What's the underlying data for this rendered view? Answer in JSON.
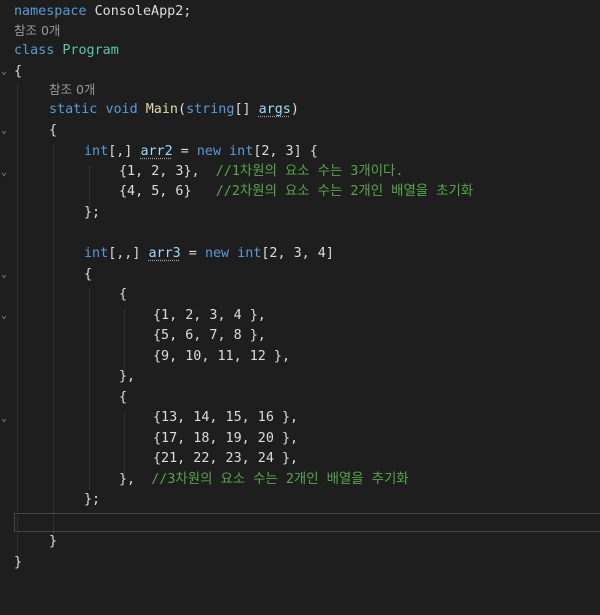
{
  "editor": {
    "lines": [
      {
        "t": "namespace ConsoleApp2;"
      },
      {
        "t": "참조 0개"
      },
      {
        "t": "class Program"
      },
      {
        "t": "{"
      },
      {
        "t": "참조 0개"
      },
      {
        "t": "static void Main(string[] args)"
      },
      {
        "t": "{"
      },
      {
        "t": "int[,] arr2 = new int[2, 3] {"
      },
      {
        "t": "{1, 2, 3},  //1차원의 요소 수는 3개이다."
      },
      {
        "t": "{4, 5, 6}   //2차원의 요소 수는 2개인 배열을 초기화"
      },
      {
        "t": "};"
      },
      {
        "t": ""
      },
      {
        "t": "int[,,] arr3 = new int[2, 3, 4]"
      },
      {
        "t": "{"
      },
      {
        "t": "{"
      },
      {
        "t": "{1, 2, 3, 4 },"
      },
      {
        "t": "{5, 6, 7, 8 },"
      },
      {
        "t": "{9, 10, 11, 12 },"
      },
      {
        "t": "},"
      },
      {
        "t": "{"
      },
      {
        "t": "{13, 14, 15, 16 },"
      },
      {
        "t": "{17, 18, 19, 20 },"
      },
      {
        "t": "{21, 22, 23, 24 },"
      },
      {
        "t": "},  //3차원의 요소 수는 2개인 배열을 추기화"
      },
      {
        "t": "};"
      },
      {
        "t": ""
      },
      {
        "t": "}"
      },
      {
        "t": "}"
      }
    ],
    "tokens": {
      "kw_namespace": "namespace",
      "ns_name": "ConsoleApp2;",
      "ref_count_1": "참조 0개",
      "kw_class": "class",
      "class_name": "Program",
      "brace_open": "{",
      "brace_close": "}",
      "ref_count_2": "참조 0개",
      "kw_static": "static",
      "kw_void": "void",
      "method_name": "Main",
      "paren_open": "(",
      "kw_string": "string",
      "arr_bracket": "[]",
      "param_name": "args",
      "paren_close": ")",
      "kw_int": "int",
      "arr2_dims": "[,]",
      "var_arr2": "arr2",
      "eq": " = ",
      "kw_new": "new",
      "arr2_size": "[2, 3] {",
      "row1": "{1, 2, 3},",
      "comment1": "//1차원의 요소 수는 3개이다.",
      "row2": "{4, 5, 6}",
      "comment2": "//2차원의 요소 수는 2개인 배열을 초기화",
      "close_semi": "};",
      "arr3_dims": "[,,]",
      "var_arr3": "arr3",
      "arr3_size": "[2, 3, 4]",
      "r3_1": "{1, 2, 3, 4 },",
      "r3_2": "{5, 6, 7, 8 },",
      "r3_3": "{9, 10, 11, 12 },",
      "block_close_comma": "},",
      "r3_4": "{13, 14, 15, 16 },",
      "r3_5": "{17, 18, 19, 20 },",
      "r3_6": "{21, 22, 23, 24 },",
      "comment3": "//3차원의 요소 수는 2개인 배열을 추기화"
    },
    "colors": {
      "background": "#1e1e1e",
      "keyword": "#569cd6",
      "type": "#4ec9b0",
      "method": "#dcdcaa",
      "parameter": "#9cdcfe",
      "comment": "#57a64a",
      "text": "#dcdcdc",
      "codelens": "#999999"
    }
  }
}
